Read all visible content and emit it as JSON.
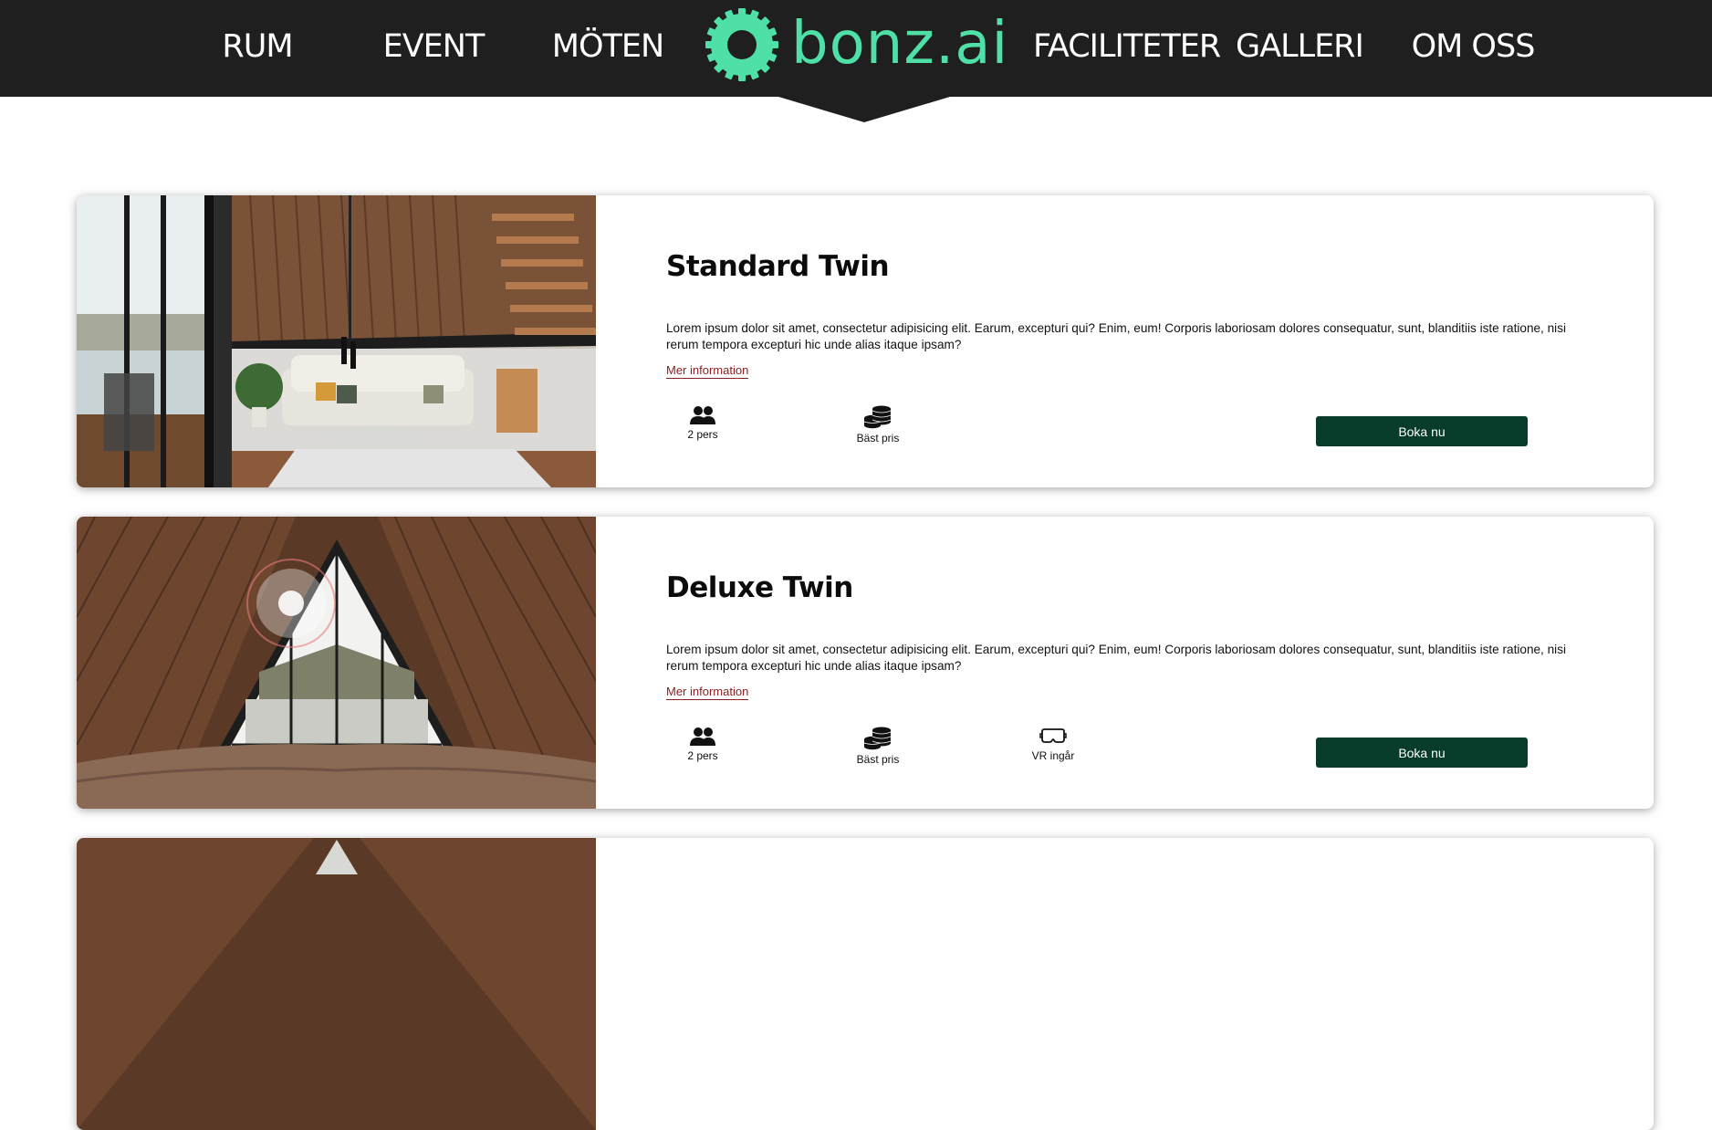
{
  "nav": {
    "left": [
      "RUM",
      "EVENT",
      "MÖTEN"
    ],
    "right": [
      "FACILITETER",
      "GALLERI",
      "OM OSS"
    ],
    "logo_text": "bonz.ai"
  },
  "colors": {
    "header_bg": "#1f1f1f",
    "logo_accent": "#4ee0a6",
    "button_bg": "#073b2a",
    "link_color": "#8b1e1e"
  },
  "rooms": [
    {
      "title": "Standard Twin",
      "description": "Lorem ipsum dolor sit amet, consectetur adipisicing elit. Earum, excepturi qui? Enim, eum! Corporis laboriosam dolores consequatur, sunt, blanditiis iste ratione, nisi rerum tempora excepturi hic unde alias itaque ipsam?",
      "more_label": "Mer information",
      "features": [
        {
          "icon": "people-icon",
          "label": "2 pers"
        },
        {
          "icon": "coins-icon",
          "label": "Bäst pris"
        }
      ],
      "book_label": "Boka nu"
    },
    {
      "title": "Deluxe Twin",
      "description": "Lorem ipsum dolor sit amet, consectetur adipisicing elit. Earum, excepturi qui? Enim, eum! Corporis laboriosam dolores consequatur, sunt, blanditiis iste ratione, nisi rerum tempora excepturi hic unde alias itaque ipsam?",
      "more_label": "Mer information",
      "features": [
        {
          "icon": "people-icon",
          "label": "2 pers"
        },
        {
          "icon": "coins-icon",
          "label": "Bäst pris"
        },
        {
          "icon": "vr-headset-icon",
          "label": "VR ingår"
        }
      ],
      "book_label": "Boka nu"
    }
  ]
}
